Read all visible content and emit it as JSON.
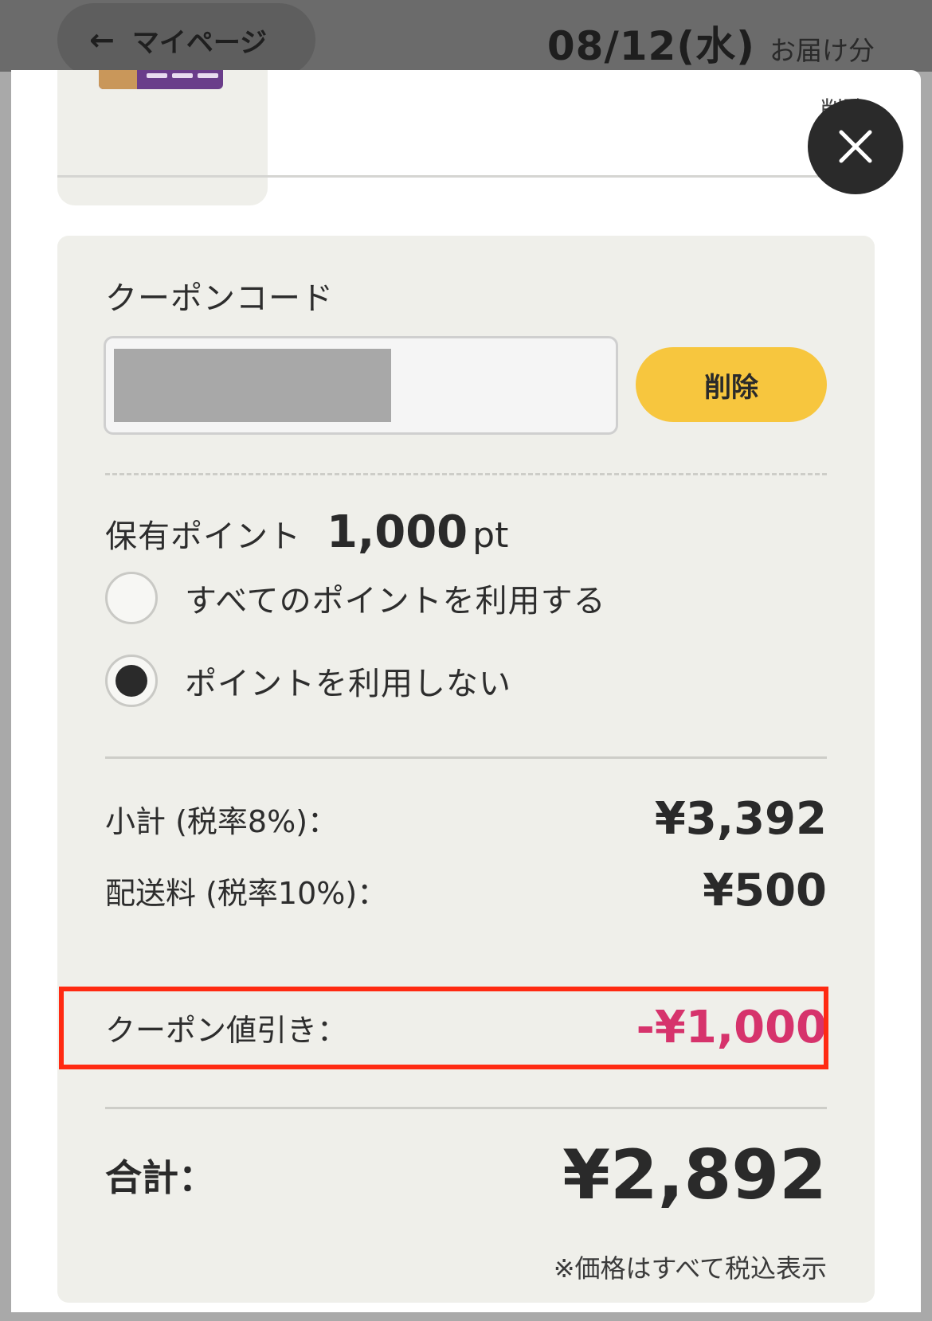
{
  "header": {
    "back_label": "マイページ",
    "delivery_date": "08/12(水)",
    "delivery_suffix": "お届け分"
  },
  "product": {
    "partial_delete_label": "削除"
  },
  "coupon": {
    "label": "クーポンコード",
    "code_value": "",
    "delete_label": "削除"
  },
  "points": {
    "label": "保有ポイント",
    "value": "1,000",
    "unit": "pt",
    "options": [
      {
        "label": "すべてのポイントを利用する",
        "selected": false
      },
      {
        "label": "ポイントを利用しない",
        "selected": true
      }
    ]
  },
  "summary": {
    "subtotal_label": "小計 (税率8%)：",
    "subtotal_value": "¥3,392",
    "shipping_label": "配送料 (税率10%)：",
    "shipping_value": "¥500",
    "coupon_discount_label": "クーポン値引き：",
    "coupon_discount_value": "-¥1,000",
    "total_label": "合計：",
    "total_value": "¥2,892",
    "tax_note": "※価格はすべて税込表示"
  },
  "colors": {
    "accent_button": "#f7c63e",
    "discount_text": "#d6336c",
    "highlight_border": "#ff2a12"
  }
}
